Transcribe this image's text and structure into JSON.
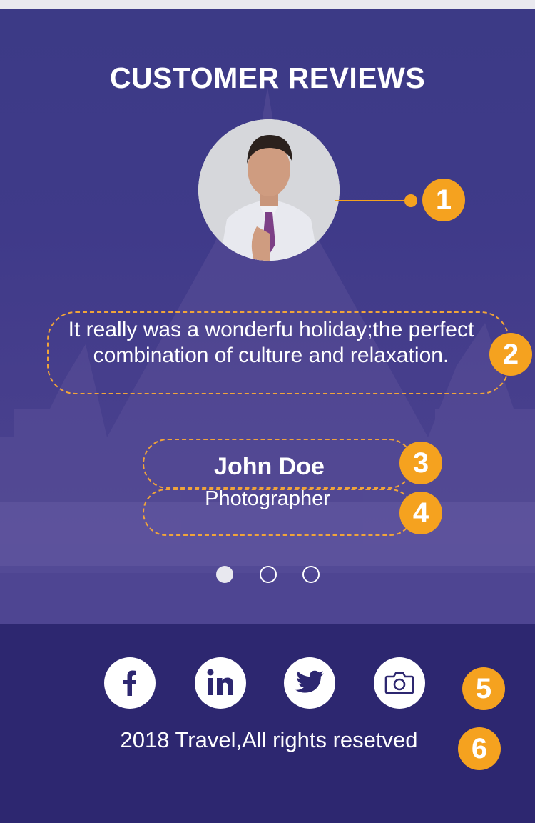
{
  "section": {
    "title": "CUSTOMER REVIEWS"
  },
  "review": {
    "quote": "It really was a wonderfu holiday;the perfect combination of culture and relaxation.",
    "name": "John Doe",
    "role": "Photographer"
  },
  "carousel": {
    "count": 3,
    "active_index": 0
  },
  "callouts": [
    "1",
    "2",
    "3",
    "4",
    "5",
    "6"
  ],
  "social": [
    {
      "icon": "facebook-icon"
    },
    {
      "icon": "linkedin-icon"
    },
    {
      "icon": "twitter-icon"
    },
    {
      "icon": "camera-icon"
    }
  ],
  "footer": {
    "copyright": "2018 Travel,All rights resetved"
  },
  "colors": {
    "background": "#3f3a89",
    "footer": "#2d2770",
    "accent": "#f5a21f",
    "text": "#ffffff"
  }
}
